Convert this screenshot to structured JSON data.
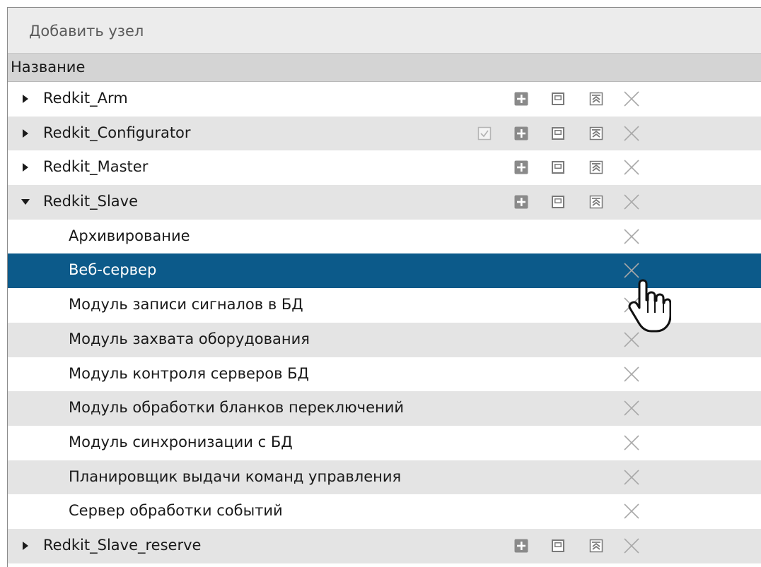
{
  "toolbar": {
    "add_node_label": "Добавить узел"
  },
  "table": {
    "column_header": "Название",
    "rows": [
      {
        "label": "Redkit_Arm",
        "level": 1,
        "expander": "collapsed",
        "check": false,
        "actions": true,
        "bg": "white"
      },
      {
        "label": "Redkit_Configurator",
        "level": 1,
        "expander": "collapsed",
        "check": true,
        "actions": true,
        "bg": "alt"
      },
      {
        "label": "Redkit_Master",
        "level": 1,
        "expander": "collapsed",
        "check": false,
        "actions": true,
        "bg": "white"
      },
      {
        "label": "Redkit_Slave",
        "level": 1,
        "expander": "expanded",
        "check": false,
        "actions": true,
        "bg": "alt"
      },
      {
        "label": "Архивирование",
        "level": 2,
        "expander": "none",
        "check": false,
        "actions": false,
        "bg": "white"
      },
      {
        "label": "Веб-сервер",
        "level": 2,
        "expander": "none",
        "check": false,
        "actions": false,
        "bg": "selected"
      },
      {
        "label": "Модуль записи сигналов в БД",
        "level": 2,
        "expander": "none",
        "check": false,
        "actions": false,
        "bg": "white"
      },
      {
        "label": "Модуль захвата оборудования",
        "level": 2,
        "expander": "none",
        "check": false,
        "actions": false,
        "bg": "alt"
      },
      {
        "label": "Модуль контроля серверов БД",
        "level": 2,
        "expander": "none",
        "check": false,
        "actions": false,
        "bg": "white"
      },
      {
        "label": "Модуль обработки бланков переключений",
        "level": 2,
        "expander": "none",
        "check": false,
        "actions": false,
        "bg": "alt"
      },
      {
        "label": "Модуль синхронизации с БД",
        "level": 2,
        "expander": "none",
        "check": false,
        "actions": false,
        "bg": "white"
      },
      {
        "label": "Планировщик выдачи команд управления",
        "level": 2,
        "expander": "none",
        "check": false,
        "actions": false,
        "bg": "alt"
      },
      {
        "label": "Сервер обработки событий",
        "level": 2,
        "expander": "none",
        "check": false,
        "actions": false,
        "bg": "white"
      },
      {
        "label": "Redkit_Slave_reserve",
        "level": 1,
        "expander": "collapsed",
        "check": false,
        "actions": true,
        "bg": "alt"
      }
    ]
  },
  "icons": {
    "add": "plus-box-icon",
    "window": "window-icon",
    "move_up": "move-top-icon",
    "remove": "close-icon",
    "check": "checkbox-icon"
  },
  "colors": {
    "selected_row": "#0c5a8a",
    "alt_row": "#e4e4e4",
    "header_bg": "#d4d4d4",
    "toolbar_bg": "#ececec"
  }
}
